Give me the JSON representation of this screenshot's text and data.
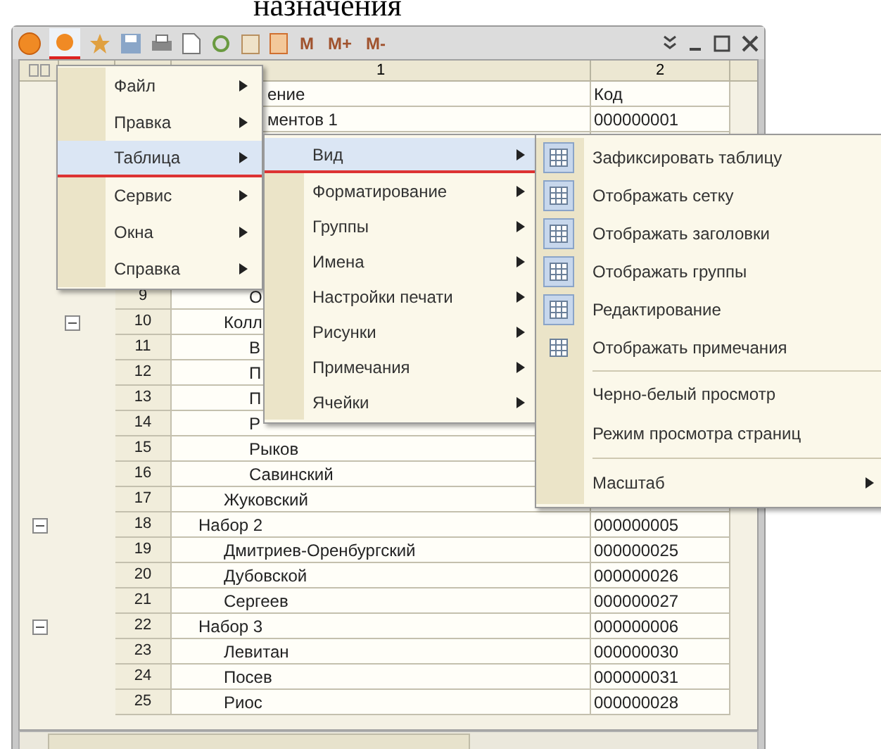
{
  "heading": "назначения",
  "toolbar": {
    "menu_button": {
      "selected": true
    },
    "memory_buttons": [
      "M",
      "M+",
      "M-"
    ]
  },
  "table": {
    "columns": [
      "1",
      "2"
    ],
    "rows": [
      {
        "kind": "covered",
        "name": "ение",
        "code": "Код"
      },
      {
        "kind": "covered",
        "name": "ментов 1",
        "code": "000000001"
      },
      {},
      {},
      {},
      {},
      {},
      {},
      {
        "kind": "subitem",
        "num": "9",
        "name": "О"
      },
      {
        "kind": "subgroup",
        "num": "10",
        "name": "Колл"
      },
      {
        "kind": "subitem",
        "num": "11",
        "name": "В"
      },
      {
        "kind": "subitem",
        "num": "12",
        "name": "П"
      },
      {
        "kind": "subitem",
        "num": "13",
        "name": "П"
      },
      {
        "kind": "subitem",
        "num": "14",
        "name": "Р"
      },
      {
        "kind": "subitem",
        "num": "15",
        "name": "Рыков"
      },
      {
        "kind": "subitem",
        "num": "16",
        "name": "Савинский"
      },
      {
        "kind": "item",
        "num": "17",
        "name": "Жуковский"
      },
      {
        "kind": "set",
        "num": "18",
        "name": "Набор 2",
        "code": "000000005"
      },
      {
        "kind": "item",
        "num": "19",
        "name": "Дмитриев-Оренбургский",
        "code": "000000025"
      },
      {
        "kind": "item",
        "num": "20",
        "name": "Дубовской",
        "code": "000000026"
      },
      {
        "kind": "item",
        "num": "21",
        "name": "Сергеев",
        "code": "000000027"
      },
      {
        "kind": "set",
        "num": "22",
        "name": "Набор 3",
        "code": "000000006"
      },
      {
        "kind": "item",
        "num": "23",
        "name": "Левитан",
        "code": "000000030"
      },
      {
        "kind": "item",
        "num": "24",
        "name": "Посев",
        "code": "000000031"
      },
      {
        "kind": "item",
        "num": "25",
        "name": "Риос",
        "code": "000000028"
      }
    ]
  },
  "main_menu": {
    "items": [
      {
        "label": "Файл",
        "selected": false
      },
      {
        "label": "Правка",
        "selected": false
      },
      {
        "label": "Таблица",
        "selected": true
      },
      {
        "label": "Сервис",
        "selected": false
      },
      {
        "label": "Окна",
        "selected": false
      },
      {
        "label": "Справка",
        "selected": false
      }
    ]
  },
  "table_menu": {
    "items": [
      {
        "label": "Вид",
        "selected": true
      },
      {
        "label": "Форматирование",
        "selected": false
      },
      {
        "label": "Группы",
        "selected": false
      },
      {
        "label": "Имена",
        "selected": false
      },
      {
        "label": "Настройки печати",
        "selected": false
      },
      {
        "label": "Рисунки",
        "selected": false
      },
      {
        "label": "Примечания",
        "selected": false
      },
      {
        "label": "Ячейки",
        "selected": false
      }
    ]
  },
  "view_menu": {
    "items": [
      {
        "kind": "toggle",
        "label": "Зафиксировать таблицу",
        "checked": true
      },
      {
        "kind": "toggle",
        "label": "Отображать сетку",
        "checked": true
      },
      {
        "kind": "toggle",
        "label": "Отображать заголовки",
        "checked": true
      },
      {
        "kind": "toggle",
        "label": "Отображать группы",
        "checked": true
      },
      {
        "kind": "toggle",
        "label": "Редактирование",
        "checked": true
      },
      {
        "kind": "toggle",
        "label": "Отображать примечания",
        "checked": false
      },
      {
        "kind": "separator"
      },
      {
        "kind": "command",
        "label": "Черно-белый просмотр"
      },
      {
        "kind": "command",
        "label": "Режим просмотра страниц"
      },
      {
        "kind": "separator"
      },
      {
        "kind": "submenu",
        "label": "Масштаб"
      }
    ]
  }
}
